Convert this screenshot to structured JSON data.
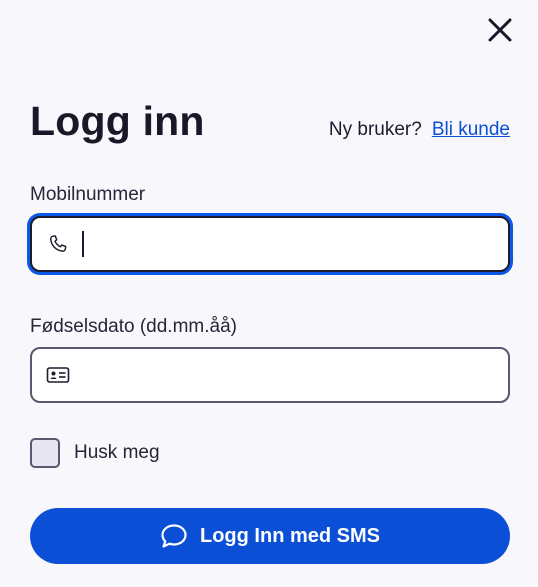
{
  "dialog": {
    "title": "Logg inn",
    "close_icon": "close-icon"
  },
  "new_user": {
    "prompt": "Ny bruker?",
    "link_label": "Bli kunde"
  },
  "mobile": {
    "label": "Mobilnummer",
    "value": "",
    "icon": "phone-icon"
  },
  "birthdate": {
    "label": "Fødselsdato (dd.mm.åå)",
    "value": "",
    "icon": "id-card-icon"
  },
  "remember": {
    "label": "Husk meg",
    "checked": false
  },
  "submit": {
    "label": "Logg Inn med SMS",
    "icon": "chat-bubble-icon"
  },
  "colors": {
    "accent": "#0b4fd6",
    "background": "#f8f7fc",
    "text": "#1f1a2e",
    "border": "#5d566f"
  }
}
